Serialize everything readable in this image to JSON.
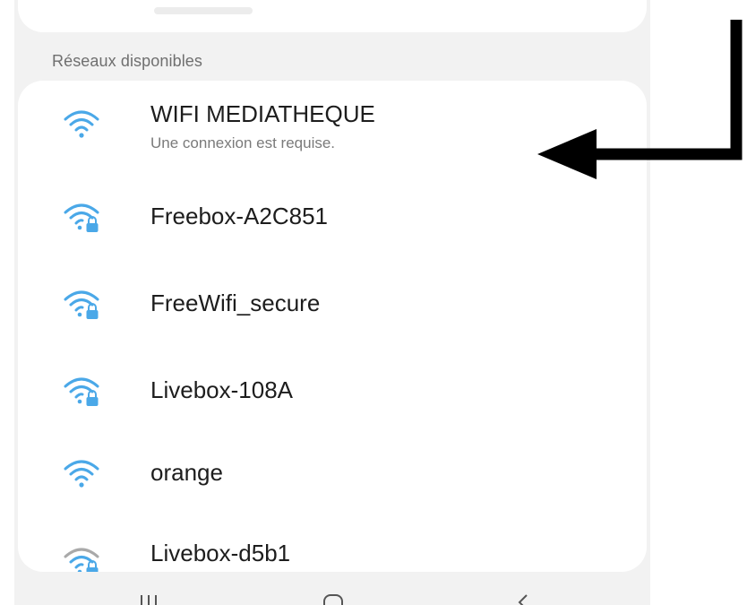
{
  "section": {
    "header": "Réseaux disponibles"
  },
  "networks": [
    {
      "name": "WIFI MEDIATHEQUE",
      "subtitle": "Une connexion est requise.",
      "icon": "wifi-open-icon",
      "secured": false
    },
    {
      "name": "Freebox-A2C851",
      "subtitle": "",
      "icon": "wifi-lock-icon",
      "secured": true
    },
    {
      "name": "FreeWifi_secure",
      "subtitle": "",
      "icon": "wifi-lock-icon",
      "secured": true
    },
    {
      "name": "Livebox-108A",
      "subtitle": "",
      "icon": "wifi-lock-icon",
      "secured": true
    },
    {
      "name": "orange",
      "subtitle": "",
      "icon": "wifi-open-icon",
      "secured": false
    },
    {
      "name": "Livebox-d5b1",
      "subtitle": "",
      "icon": "wifi-lock-icon",
      "secured": true
    }
  ],
  "navigation": {
    "recents_icon": "recent-apps-icon",
    "home_icon": "home-icon",
    "back_icon": "back-icon"
  },
  "annotation": {
    "icon": "pointer-arrow-icon"
  },
  "colors": {
    "wifi_accent": "#4aa8e8",
    "wifi_faded": "#a9a9a9",
    "background": "#f2f2f2",
    "card": "#ffffff",
    "primary_text": "#1d1d1d",
    "secondary_text": "#7a7a7a",
    "arrow": "#000000"
  }
}
